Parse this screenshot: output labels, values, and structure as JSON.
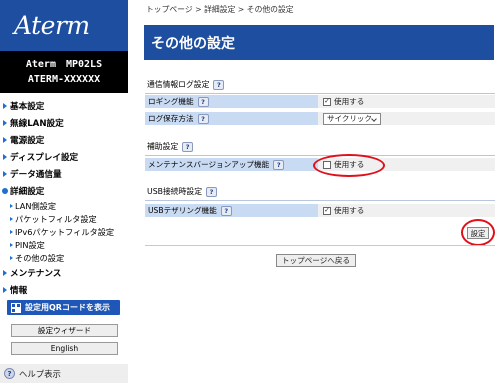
{
  "sidebar": {
    "logo": "Aterm",
    "model_line1": "Aterm　MP02LS",
    "model_line2": "ATERM-XXXXXX",
    "nav": [
      {
        "label": "基本設定"
      },
      {
        "label": "無線LAN設定"
      },
      {
        "label": "電源設定"
      },
      {
        "label": "ディスプレイ設定"
      },
      {
        "label": "データ通信量"
      },
      {
        "label": "詳細設定"
      }
    ],
    "sub_items": [
      {
        "label": "LAN側設定"
      },
      {
        "label": "パケットフィルタ設定"
      },
      {
        "label": "IPv6パケットフィルタ設定"
      },
      {
        "label": "PIN設定"
      },
      {
        "label": "その他の設定"
      }
    ],
    "nav_bottom": [
      {
        "label": "メンテナンス"
      },
      {
        "label": "情報"
      }
    ],
    "qr_button": "設定用QRコードを表示",
    "wizard_button": "設定ウィザード",
    "english_button": "English",
    "help": "ヘルプ表示",
    "help_icon": "?"
  },
  "main": {
    "breadcrumb": "トップページ > 詳細設定 > その他の設定",
    "title": "その他の設定",
    "qmark": "?",
    "sections": {
      "comm_log": {
        "heading": "通信情報ログ設定",
        "rows": [
          {
            "label": "ロギング機能",
            "checkbox_label": "使用する",
            "checked": true
          },
          {
            "label": "ログ保存方法",
            "select_value": "サイクリック"
          }
        ]
      },
      "assist": {
        "heading": "補助設定",
        "rows": [
          {
            "label": "メンテナンスバージョンアップ機能",
            "checkbox_label": "使用する",
            "checked": false
          }
        ]
      },
      "usb": {
        "heading": "USB接続時設定",
        "rows": [
          {
            "label": "USBテザリング機能",
            "checkbox_label": "使用する",
            "checked": true
          }
        ]
      }
    },
    "set_button": "設定",
    "top_button": "トップページへ戻る",
    "check_mark": "✓"
  },
  "colors": {
    "brand_blue": "#1d4e9f",
    "row_label_bg": "#c9daf3",
    "highlight_red": "#e0101a"
  }
}
